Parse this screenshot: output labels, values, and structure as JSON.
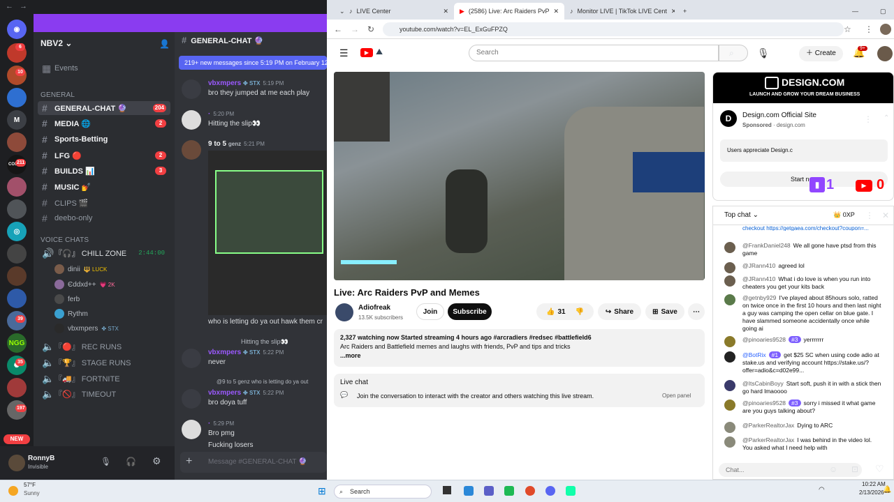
{
  "discord": {
    "server_name": "NBV2",
    "events_label": "Events",
    "category_general": "GENERAL",
    "channels": [
      {
        "name": "GENERAL-CHAT 🔮",
        "badge": "204"
      },
      {
        "name": "MEDIA 🌐",
        "badge": "2"
      },
      {
        "name": "Sports-Betting",
        "badge": ""
      },
      {
        "name": "LFG 🔴",
        "badge": "2"
      },
      {
        "name": "BUILDS 📊",
        "badge": "3"
      },
      {
        "name": "MUSIC 💅",
        "badge": ""
      },
      {
        "name": "CLIPS 🎬",
        "badge": ""
      },
      {
        "name": "deebo-only",
        "badge": ""
      }
    ],
    "category_voice": "VOICE CHATS",
    "voice_channels": [
      {
        "name": "『🎧』 CHILL ZONE",
        "time": "2:44:00"
      },
      {
        "name": "『🔴』 REC RUNS",
        "time": ""
      },
      {
        "name": "『🏆』 STAGE RUNS",
        "time": ""
      },
      {
        "name": "『🚚』 FORTNITE",
        "time": ""
      },
      {
        "name": "『🚫』 TIMEOUT",
        "time": ""
      }
    ],
    "voice_users": [
      {
        "name": "dinii",
        "tag": "🔱 LUCK"
      },
      {
        "name": "Єddxd++",
        "tag": "💗 2K"
      },
      {
        "name": "ferb",
        "tag": ""
      },
      {
        "name": "Rythm",
        "tag": ""
      },
      {
        "name": "vbxmpers",
        "tag": "✤ STX"
      }
    ],
    "server_badges": [
      "6",
      "10",
      "",
      "",
      "",
      "211",
      "",
      "",
      "",
      "",
      "",
      "39",
      "",
      "35",
      "",
      "197",
      "",
      ""
    ],
    "new_label": "NEW",
    "user": {
      "name": "RonnyB",
      "status": "Invisible"
    },
    "chat_channel": "GENERAL-CHAT 🔮",
    "new_messages": "219+ new messages since 5:19 PM on February 12, 2026",
    "messages": [
      {
        "author": "vbxmpers",
        "tag": "✤ STX",
        "time": "5:19 PM",
        "text": "bro they jumped at me each play"
      },
      {
        "author": "·",
        "tag": "",
        "time": "5:20 PM",
        "text": "Hitting the slip👀"
      },
      {
        "author": "9 to 5",
        "tag": "genz",
        "time": "5:21 PM",
        "text": ""
      },
      {
        "author": "",
        "tag": "",
        "time": "",
        "text": "who is letting do ya out hawk them cr"
      },
      {
        "author": "vbxmpers",
        "tag": "✤ STX",
        "time": "5:22 PM",
        "text": "never",
        "reply": "Hitting the slip👀"
      },
      {
        "author": "vbxmpers",
        "tag": "✤ STX",
        "time": "5:22 PM",
        "text": "bro doya tuff",
        "reply": "@9 to 5 genz who is letting do ya out"
      },
      {
        "author": "·",
        "tag": "",
        "time": "5:29 PM",
        "text": "Bro pmg"
      },
      {
        "author": "",
        "tag": "",
        "time": "",
        "text": "Fucking losers"
      }
    ],
    "composer_placeholder": "Message #GENERAL-CHAT 🔮"
  },
  "browser": {
    "tabs": [
      {
        "title": "LIVE Center"
      },
      {
        "title": "(2586) Live: Arc Raiders PvP"
      },
      {
        "title": "Monitor LIVE | TikTok LIVE Cent"
      }
    ],
    "url": "youtube.com/watch?v=EL_ExGuFPZQ",
    "search_placeholder": "Search",
    "create_label": "Create",
    "notif_count": "9+"
  },
  "video": {
    "title": "Live: Arc Raiders PvP and Memes",
    "channel": "Adiofreak",
    "subscribers": "13.5K subscribers",
    "join_label": "Join",
    "subscribe_label": "Subscribe",
    "likes": "31",
    "share_label": "Share",
    "save_label": "Save",
    "desc_stats": "2,327 watching now  Started streaming 4 hours ago  #arcradiers #redsec #battlefield6",
    "desc_text": "Arc Raiders and Battlefield memes and laughs with friends, PvP and tips and tricks",
    "more_label": "...more",
    "livechat_title": "Live chat",
    "livechat_text": "Join the conversation to interact with the creator and others watching this live stream.",
    "open_panel": "Open panel"
  },
  "ad": {
    "brand": "DESIGN.COM",
    "tagline": "LAUNCH AND GROW YOUR DREAM BUSINESS",
    "site_title": "Design.com Official Site",
    "sponsored": "Sponsored",
    "domain": "design.com",
    "quote": "Users appreciate Design.c",
    "cta": "Start now",
    "twitch_count": "1",
    "yt_count": "0"
  },
  "chat": {
    "mode": "Top chat",
    "points": "0XP",
    "first_line": "checkout https://getgaea.com/checkout?coupon=...",
    "messages": [
      {
        "user": "@FrankDaniel248",
        "badge": "",
        "text": "We all gone have ptsd from this game"
      },
      {
        "user": "@JRann410",
        "badge": "",
        "text": "agreed lol"
      },
      {
        "user": "@JRann410",
        "badge": "",
        "text": "What i do love is when you run into cheaters you get your kits back"
      },
      {
        "user": "@getnby929",
        "badge": "",
        "text": "I've played about 85hours solo, ratted on twice once in the first 10 hours and then last night a guy was camping the open cellar on blue gate. I have slammed someone accidentally once while going ai"
      },
      {
        "user": "@pinoaries9528",
        "badge": "#3",
        "text": "yerrrrrrr"
      },
      {
        "user": "@BotRix",
        "badge": "#1",
        "text": "get $25 SC when using code adio at stake.us and verifying account https://stake.us/?offer=adio&c=d02e99..."
      },
      {
        "user": "@ItsCabinBoyy",
        "badge": "",
        "text": "Start soft, push it in with a stick then go hard lmaoooo"
      },
      {
        "user": "@pinoaries9528",
        "badge": "#3",
        "text": "sorry i missed it what game are you guys talking about?"
      },
      {
        "user": "@ParkerRealtorJax",
        "badge": "",
        "text": "Dying to ARC"
      },
      {
        "user": "@ParkerRealtorJax",
        "badge": "",
        "text": "I was behind in the video lol. You asked what I need help with"
      }
    ],
    "input_placeholder": "Chat..."
  },
  "taskbar": {
    "weather_temp": "57°F",
    "weather_desc": "Sunny",
    "search_label": "Search",
    "time": "10:22 AM",
    "date": "2/13/2026"
  }
}
